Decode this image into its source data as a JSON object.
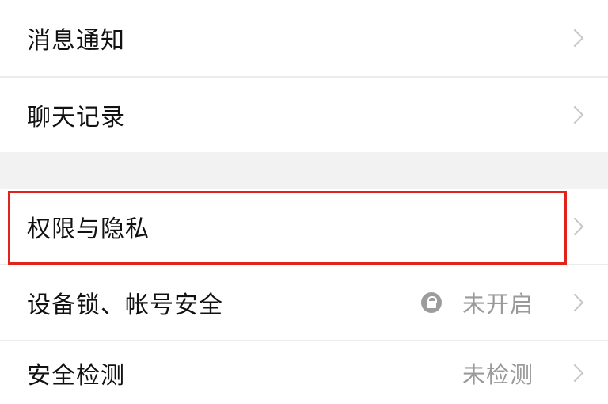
{
  "settings": {
    "items": [
      {
        "label": "消息通知",
        "icon": "chevron-right-icon"
      },
      {
        "label": "聊天记录",
        "icon": "chevron-right-icon"
      },
      {
        "label": "权限与隐私",
        "icon": "chevron-right-icon",
        "highlighted": true
      },
      {
        "label": "设备锁、帐号安全",
        "value": "未开启",
        "status_icon": "lock-icon",
        "icon": "chevron-right-icon"
      },
      {
        "label": "安全检测",
        "value": "未检测",
        "icon": "chevron-right-icon"
      }
    ]
  },
  "colors": {
    "highlight_border": "#e0241b",
    "section_gap": "#f2f2f2",
    "secondary_text": "#9a9a9a"
  }
}
